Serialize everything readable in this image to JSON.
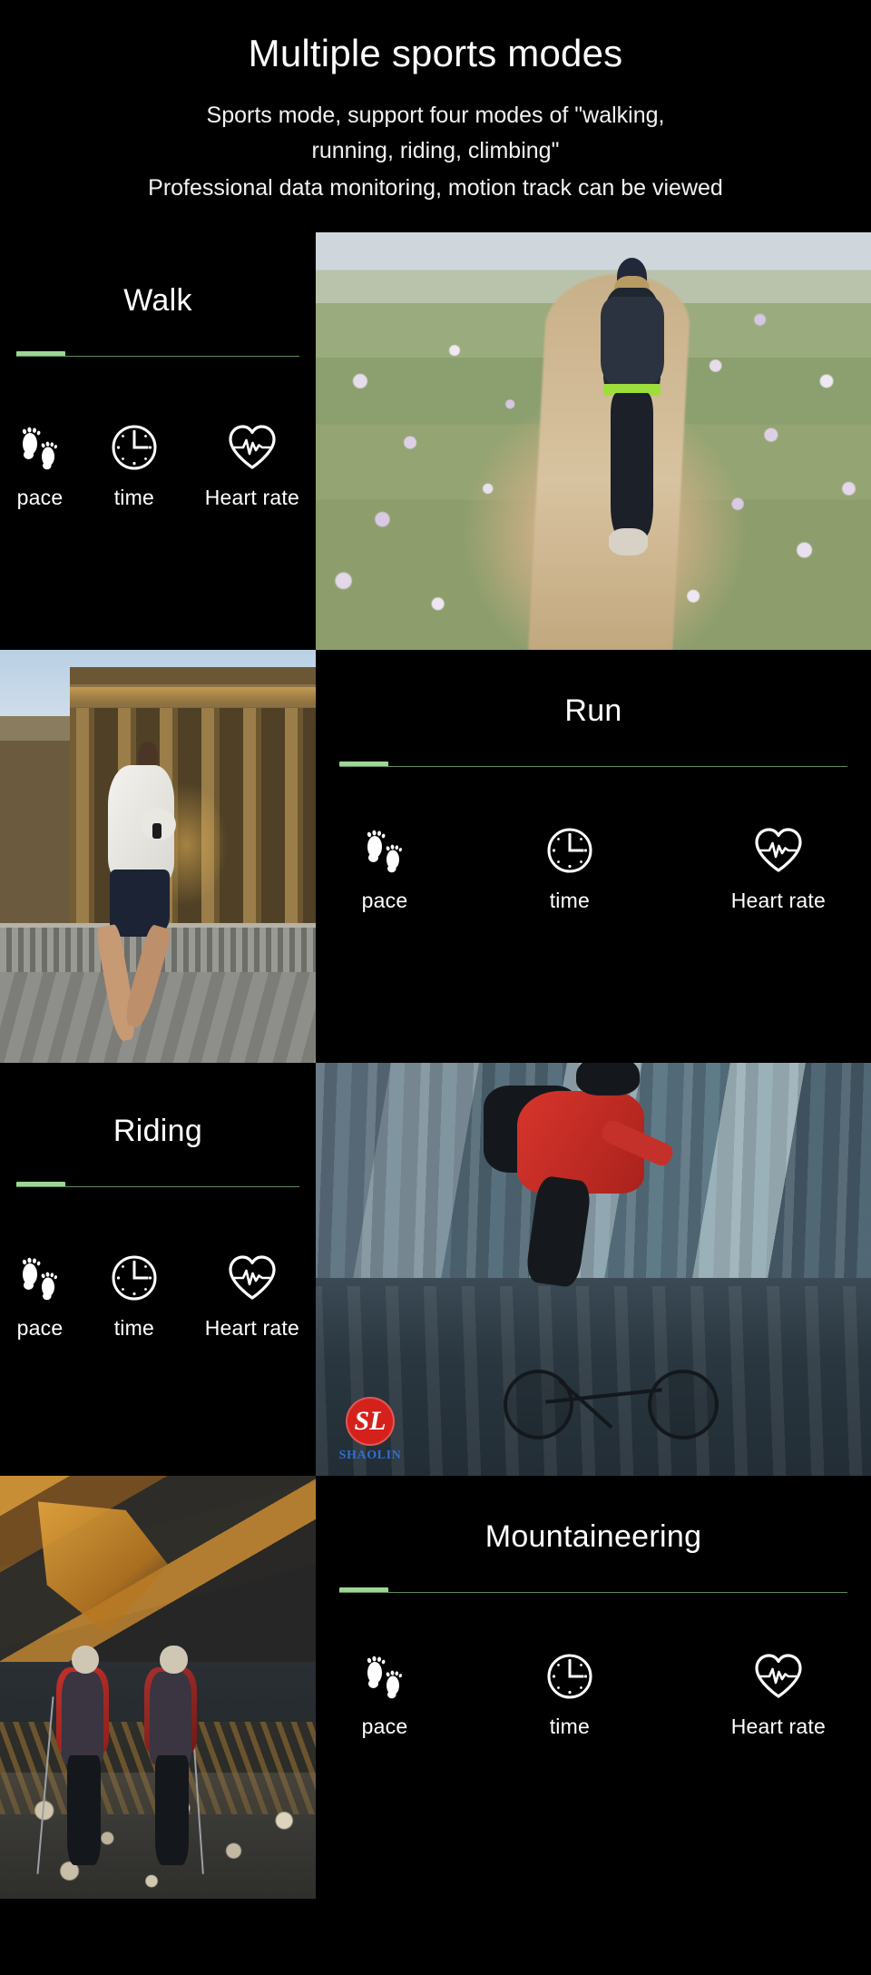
{
  "header": {
    "title": "Multiple sports modes",
    "subtitle_line1": "Sports mode, support four modes of \"walking,",
    "subtitle_line2": "running, riding, climbing\"",
    "subtitle_line3": "Professional data monitoring, motion track can be viewed"
  },
  "accent_color": "#9fd697",
  "accent_line_color": "#5f8d5c",
  "background_color": "#000000",
  "metric_labels": {
    "pace": "pace",
    "time": "time",
    "heart_rate": "Heart rate"
  },
  "sections": [
    {
      "title": "Walk",
      "metrics": [
        {
          "label": "pace",
          "icon": "footprints-icon"
        },
        {
          "label": "time",
          "icon": "clock-icon"
        },
        {
          "label": "Heart rate",
          "icon": "heart-pulse-icon"
        }
      ],
      "photo_alt": "woman walking on sandy path through purple wildflowers"
    },
    {
      "title": "Run",
      "metrics": [
        {
          "label": "pace",
          "icon": "footprints-icon"
        },
        {
          "label": "time",
          "icon": "clock-icon"
        },
        {
          "label": "Heart rate",
          "icon": "heart-pulse-icon"
        }
      ],
      "photo_alt": "man running past a classical columned building at dusk"
    },
    {
      "title": "Riding",
      "metrics": [
        {
          "label": "pace",
          "icon": "footprints-icon"
        },
        {
          "label": "time",
          "icon": "clock-icon"
        },
        {
          "label": "Heart rate",
          "icon": "heart-pulse-icon"
        }
      ],
      "photo_alt": "cyclist in red jersey riding through blurred city street"
    },
    {
      "title": "Mountaineering",
      "metrics": [
        {
          "label": "pace",
          "icon": "footprints-icon"
        },
        {
          "label": "time",
          "icon": "clock-icon"
        },
        {
          "label": "Heart rate",
          "icon": "heart-pulse-icon"
        }
      ],
      "photo_alt": "two hikers with backpacks on a sunlit mountain slope"
    }
  ],
  "brand": {
    "monogram": "SL",
    "wordmark": "SHAOLIN",
    "mark_color": "#d4211c",
    "wordmark_color": "#2f6fd0"
  }
}
